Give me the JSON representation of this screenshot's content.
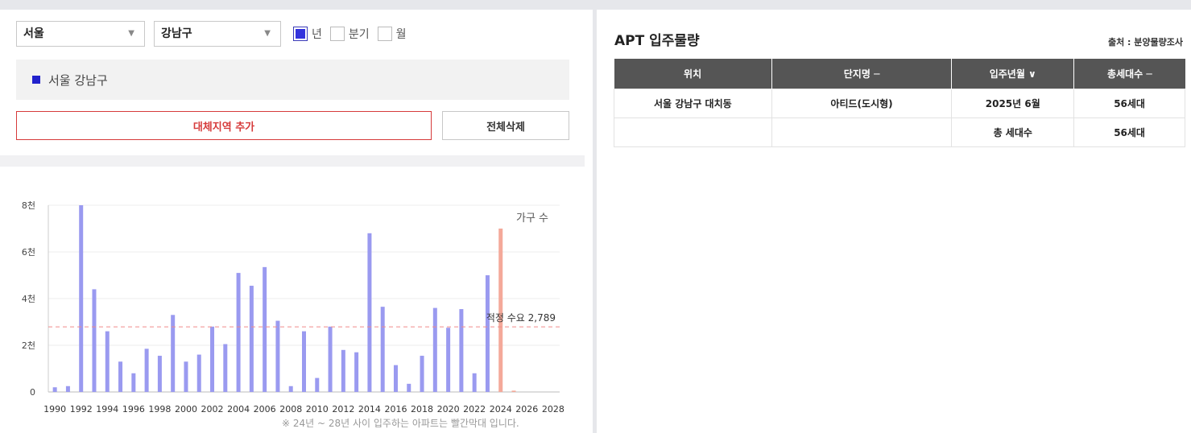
{
  "filters": {
    "city": "서울",
    "district": "강남구",
    "periods": [
      {
        "label": "년",
        "checked": true
      },
      {
        "label": "분기",
        "checked": false
      },
      {
        "label": "월",
        "checked": false
      }
    ]
  },
  "selected_region": "서울 강남구",
  "buttons": {
    "add_region": "대체지역 추가",
    "delete_all": "전체삭제"
  },
  "chart_data": {
    "type": "bar",
    "series_label": "가구 수",
    "reference_line": {
      "label": "적정 수요 2,789",
      "value": 2789
    },
    "ylim": [
      0,
      8000
    ],
    "y_ticks": [
      {
        "value": 0,
        "label": "0"
      },
      {
        "value": 2000,
        "label": "2천"
      },
      {
        "value": 4000,
        "label": "4천"
      },
      {
        "value": 6000,
        "label": "6천"
      },
      {
        "value": 8000,
        "label": "8천"
      }
    ],
    "x_tick_labels": [
      "1990",
      "1992",
      "1994",
      "1996",
      "1998",
      "2000",
      "2002",
      "2004",
      "2006",
      "2008",
      "2010",
      "2012",
      "2014",
      "2016",
      "2018",
      "2020",
      "2022",
      "2024",
      "2026",
      "2028"
    ],
    "x_start": 1990,
    "x_end": 2028,
    "highlight_from": 2024,
    "colors": {
      "normal": "#9a9af0",
      "future": "#f4a99a",
      "reference": "#f08a8a"
    },
    "bars": [
      {
        "year": 1990,
        "value": 200
      },
      {
        "year": 1991,
        "value": 250
      },
      {
        "year": 1992,
        "value": 8000
      },
      {
        "year": 1993,
        "value": 4400
      },
      {
        "year": 1994,
        "value": 2600
      },
      {
        "year": 1995,
        "value": 1300
      },
      {
        "year": 1996,
        "value": 800
      },
      {
        "year": 1997,
        "value": 1850
      },
      {
        "year": 1998,
        "value": 1550
      },
      {
        "year": 1999,
        "value": 3300
      },
      {
        "year": 2000,
        "value": 1300
      },
      {
        "year": 2001,
        "value": 1600
      },
      {
        "year": 2002,
        "value": 2800
      },
      {
        "year": 2003,
        "value": 2050
      },
      {
        "year": 2004,
        "value": 5100
      },
      {
        "year": 2005,
        "value": 4550
      },
      {
        "year": 2006,
        "value": 5350
      },
      {
        "year": 2007,
        "value": 3050
      },
      {
        "year": 2008,
        "value": 250
      },
      {
        "year": 2009,
        "value": 2600
      },
      {
        "year": 2010,
        "value": 600
      },
      {
        "year": 2011,
        "value": 2800
      },
      {
        "year": 2012,
        "value": 1800
      },
      {
        "year": 2013,
        "value": 1700
      },
      {
        "year": 2014,
        "value": 6800
      },
      {
        "year": 2015,
        "value": 3650
      },
      {
        "year": 2016,
        "value": 1150
      },
      {
        "year": 2017,
        "value": 350
      },
      {
        "year": 2018,
        "value": 1550
      },
      {
        "year": 2019,
        "value": 3600
      },
      {
        "year": 2020,
        "value": 2750
      },
      {
        "year": 2021,
        "value": 3550
      },
      {
        "year": 2022,
        "value": 800
      },
      {
        "year": 2023,
        "value": 5000
      },
      {
        "year": 2024,
        "value": 7000
      },
      {
        "year": 2025,
        "value": 56
      }
    ]
  },
  "footnote": "※ 24년 ~ 28년 사이 입주하는 아파트는 빨간막대 입니다.",
  "apt": {
    "title": "APT 입주물량",
    "source": "출처 : 분양물량조사",
    "columns": [
      "위치",
      "단지명 ─",
      "입주년월 ∨",
      "총세대수 ─"
    ],
    "rows": [
      {
        "location": "서울 강남구 대치동",
        "name": "아티드(도시형)",
        "date": "2025년 6월",
        "total": "56세대"
      }
    ],
    "summary": {
      "label": "총 세대수",
      "total": "56세대"
    }
  }
}
